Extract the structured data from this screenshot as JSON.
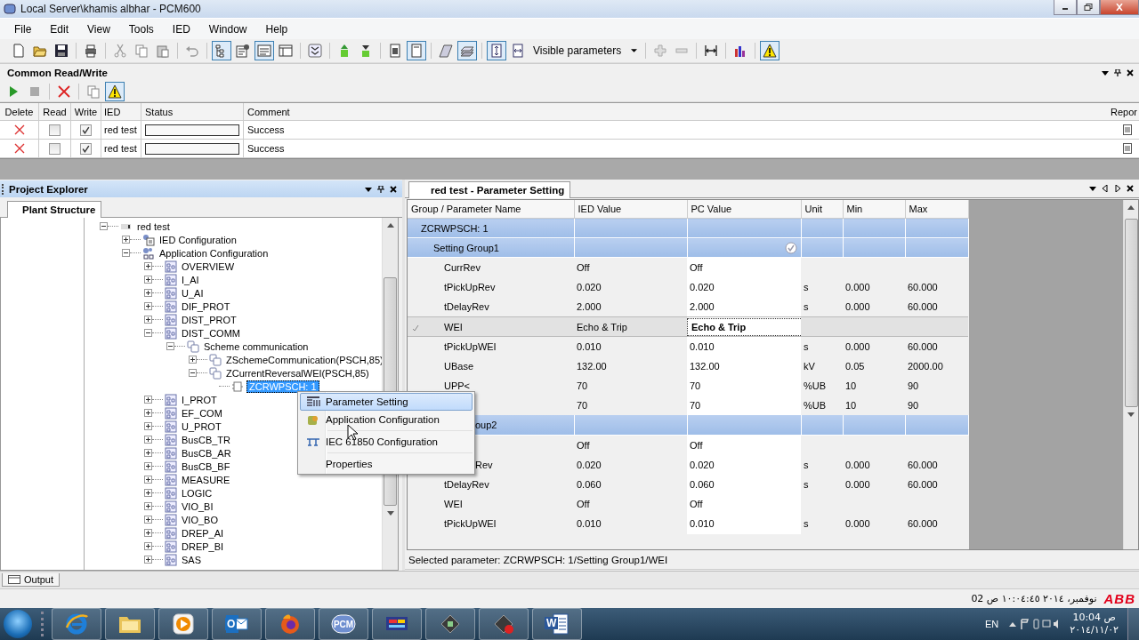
{
  "window": {
    "title": "Local Server\\khamis albhar - PCM600"
  },
  "menu": [
    "File",
    "Edit",
    "View",
    "Tools",
    "IED",
    "Window",
    "Help"
  ],
  "toolbar": [
    {
      "kind": "new",
      "pressed": false
    },
    {
      "kind": "open",
      "pressed": false
    },
    {
      "kind": "save",
      "pressed": false
    },
    {
      "kind": "sep"
    },
    {
      "kind": "print",
      "pressed": false
    },
    {
      "kind": "sep"
    },
    {
      "kind": "cut",
      "pressed": false
    },
    {
      "kind": "copy",
      "pressed": false
    },
    {
      "kind": "paste",
      "pressed": false
    },
    {
      "kind": "sep"
    },
    {
      "kind": "undo",
      "pressed": false
    },
    {
      "kind": "sep"
    },
    {
      "kind": "tree",
      "pressed": true
    },
    {
      "kind": "props",
      "pressed": false
    },
    {
      "kind": "view",
      "pressed": true
    },
    {
      "kind": "panel",
      "pressed": false
    },
    {
      "kind": "sep"
    },
    {
      "kind": "expand",
      "pressed": false
    },
    {
      "kind": "sep"
    },
    {
      "kind": "upload",
      "pressed": false
    },
    {
      "kind": "download",
      "pressed": false
    },
    {
      "kind": "sep"
    },
    {
      "kind": "doc",
      "pressed": false
    },
    {
      "kind": "page",
      "pressed": true
    },
    {
      "kind": "sep"
    },
    {
      "kind": "layer",
      "pressed": false
    },
    {
      "kind": "layers",
      "pressed": true
    },
    {
      "kind": "sep"
    },
    {
      "kind": "fitv",
      "pressed": true
    },
    {
      "kind": "fith",
      "pressed": false
    },
    {
      "kind": "dropdown",
      "label": "Visible parameters"
    },
    {
      "kind": "sep"
    },
    {
      "kind": "plus",
      "pressed": false
    },
    {
      "kind": "minus",
      "pressed": false
    },
    {
      "kind": "sep"
    },
    {
      "kind": "width",
      "pressed": false
    },
    {
      "kind": "sep"
    },
    {
      "kind": "chart",
      "pressed": false
    },
    {
      "kind": "sep"
    },
    {
      "kind": "warning",
      "pressed": true
    }
  ],
  "read_write": {
    "title": "Common Read/Write",
    "toolbar": [
      {
        "kind": "play",
        "pressed": false
      },
      {
        "kind": "stop",
        "pressed": false
      },
      {
        "kind": "sep"
      },
      {
        "kind": "delete",
        "pressed": false
      },
      {
        "kind": "sep"
      },
      {
        "kind": "copy",
        "pressed": false
      },
      {
        "kind": "warning",
        "pressed": true
      }
    ],
    "columns": [
      "Delete",
      "Read",
      "Write",
      "IED",
      "Status",
      "Comment",
      "Repor"
    ],
    "rows": [
      {
        "read": false,
        "write": true,
        "ied": "red test",
        "level": 0,
        "comment": "Success"
      },
      {
        "read": false,
        "write": true,
        "ied": "red test",
        "level": 0,
        "comment": "Success"
      }
    ]
  },
  "project_explorer": {
    "title": "Project Explorer",
    "tabs": [
      {
        "label": "Plant Structure",
        "selected": true
      }
    ],
    "tree": [
      {
        "label": "red test",
        "kind": "device",
        "expanded": true,
        "selected": false,
        "children": [
          {
            "label": "IED Configuration",
            "kind": "ied-config",
            "expanded": false,
            "selected": false
          },
          {
            "label": "Application Configuration",
            "kind": "app-config",
            "expanded": true,
            "selected": false,
            "children": [
              {
                "label": "OVERVIEW",
                "kind": "page",
                "expanded": false,
                "selected": false
              },
              {
                "label": "I_AI",
                "kind": "page",
                "expanded": false,
                "selected": false
              },
              {
                "label": "U_AI",
                "kind": "page",
                "expanded": false,
                "selected": false
              },
              {
                "label": "DIF_PROT",
                "kind": "page",
                "expanded": false,
                "selected": false
              },
              {
                "label": "DIST_PROT",
                "kind": "page",
                "expanded": false,
                "selected": false
              },
              {
                "label": "DIST_COMM",
                "kind": "page",
                "expanded": true,
                "selected": false,
                "children": [
                  {
                    "label": "Scheme communication",
                    "kind": "scheme",
                    "expanded": true,
                    "selected": false,
                    "children": [
                      {
                        "label": "ZSchemeCommunication(PSCH,85)",
                        "kind": "scheme",
                        "expanded": false,
                        "selected": false
                      },
                      {
                        "label": "ZCurrentReversalWEI(PSCH,85)",
                        "kind": "scheme",
                        "expanded": true,
                        "selected": false,
                        "children": [
                          {
                            "label": "ZCRWPSCH: 1",
                            "kind": "function",
                            "selected": true
                          }
                        ]
                      }
                    ]
                  }
                ]
              },
              {
                "label": "I_PROT",
                "kind": "page",
                "expanded": false,
                "selected": false
              },
              {
                "label": "EF_COM",
                "kind": "page",
                "expanded": false,
                "selected": false
              },
              {
                "label": "U_PROT",
                "kind": "page",
                "expanded": false,
                "selected": false
              },
              {
                "label": "BusCB_TR",
                "kind": "page",
                "expanded": false,
                "selected": false
              },
              {
                "label": "BusCB_AR",
                "kind": "page",
                "expanded": false,
                "selected": false
              },
              {
                "label": "BusCB_BF",
                "kind": "page",
                "expanded": false,
                "selected": false
              },
              {
                "label": "MEASURE",
                "kind": "page",
                "expanded": false,
                "selected": false
              },
              {
                "label": "LOGIC",
                "kind": "page",
                "expanded": false,
                "selected": false
              },
              {
                "label": "VIO_BI",
                "kind": "page",
                "expanded": false,
                "selected": false
              },
              {
                "label": "VIO_BO",
                "kind": "page",
                "expanded": false,
                "selected": false
              },
              {
                "label": "DREP_AI",
                "kind": "page",
                "expanded": false,
                "selected": false
              },
              {
                "label": "DREP_BI",
                "kind": "page",
                "expanded": false,
                "selected": false
              },
              {
                "label": "SAS",
                "kind": "page",
                "expanded": false,
                "selected": false
              }
            ]
          }
        ]
      }
    ]
  },
  "context_menu": [
    {
      "label": "Parameter Setting",
      "kind": "table",
      "selected": true,
      "separator": false
    },
    {
      "label": "Application Configuration",
      "kind": "app",
      "selected": false,
      "separator": false
    },
    {
      "label": "IEC 61850 Configuration",
      "kind": "network",
      "selected": false,
      "separator": true
    },
    {
      "label": "Properties",
      "kind": "none",
      "selected": false,
      "separator": true
    }
  ],
  "parameter_panel": {
    "tab": "red test - Parameter Setting",
    "columns": [
      "Group / Parameter Name",
      "IED Value",
      "PC Value",
      "Unit",
      "Min",
      "Max"
    ],
    "rows": [
      {
        "kind": "function",
        "name": "ZCRWPSCH: 1",
        "selected": false
      },
      {
        "kind": "group",
        "name": "Setting Group1",
        "applied": true,
        "selected": false
      },
      {
        "kind": "param",
        "name": "CurrRev",
        "ied": "Off",
        "pc": "Off",
        "selected": false
      },
      {
        "kind": "param",
        "name": "tPickUpRev",
        "ied": "0.020",
        "pc": "0.020",
        "unit": "s",
        "min": "0.000",
        "max": "60.000",
        "selected": false
      },
      {
        "kind": "param",
        "name": "tDelayRev",
        "ied": "2.000",
        "pc": "2.000",
        "unit": "s",
        "min": "0.000",
        "max": "60.000",
        "selected": false
      },
      {
        "kind": "param",
        "name": "WEI",
        "ied": "Echo & Trip",
        "pc": "Echo & Trip",
        "selected": true
      },
      {
        "kind": "param",
        "name": "tPickUpWEI",
        "ied": "0.010",
        "pc": "0.010",
        "unit": "s",
        "min": "0.000",
        "max": "60.000",
        "selected": false
      },
      {
        "kind": "param",
        "name": "UBase",
        "ied": "132.00",
        "pc": "132.00",
        "unit": "kV",
        "min": "0.05",
        "max": "2000.00",
        "selected": false
      },
      {
        "kind": "param",
        "name": "UPP<",
        "ied": "70",
        "pc": "70",
        "unit": "%UB",
        "min": "10",
        "max": "90",
        "selected": false
      },
      {
        "kind": "param",
        "ied": "70",
        "pc": "70",
        "unit": "%UB",
        "min": "10",
        "max": "90",
        "selected": false
      },
      {
        "kind": "group",
        "name": "oup2",
        "clipped": true,
        "selected": false
      },
      {
        "kind": "param",
        "ied": "Off",
        "pc": "Off",
        "selected": false
      },
      {
        "kind": "param",
        "name": "Rev",
        "clipped": true,
        "ied": "0.020",
        "pc": "0.020",
        "unit": "s",
        "min": "0.000",
        "max": "60.000",
        "selected": false
      },
      {
        "kind": "param",
        "name": "tDelayRev",
        "ied": "0.060",
        "pc": "0.060",
        "unit": "s",
        "min": "0.000",
        "max": "60.000",
        "selected": false
      },
      {
        "kind": "param",
        "name": "WEI",
        "ied": "Off",
        "pc": "Off",
        "selected": false
      },
      {
        "kind": "param",
        "name": "tPickUpWEI",
        "ied": "0.010",
        "pc": "0.010",
        "unit": "s",
        "min": "0.000",
        "max": "60.000",
        "selected": false
      }
    ],
    "status": "Selected parameter: ZCRWPSCH: 1/Setting Group1/WEI"
  },
  "output_tab": {
    "label": "Output"
  },
  "status_bar": {
    "datetime": "نوفمبر، ٢٠١٤ ١٠:٠٤:٤٥ ص 02",
    "logo": "ABB"
  },
  "taskbar": {
    "apps": [
      {
        "kind": "ie"
      },
      {
        "kind": "folder"
      },
      {
        "kind": "media"
      },
      {
        "kind": "outlook",
        "label": "O"
      },
      {
        "kind": "firefox"
      },
      {
        "kind": "pcm",
        "label": "PCM"
      },
      {
        "kind": "monitor"
      },
      {
        "kind": "chip"
      },
      {
        "kind": "chip-stop"
      },
      {
        "kind": "word",
        "label": "W"
      }
    ],
    "language": "EN",
    "time": "10:04 ص",
    "date": "٢٠١٤/١١/٠٢"
  }
}
